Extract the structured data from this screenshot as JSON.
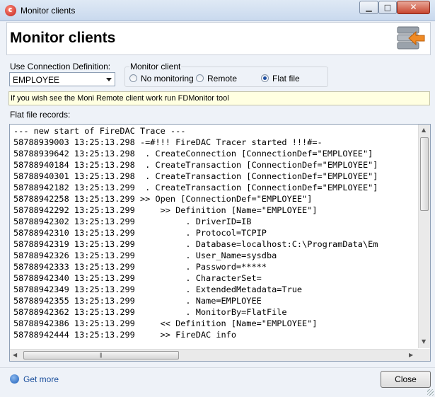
{
  "window": {
    "title": "Monitor clients",
    "minimize": "▁",
    "maximize": "□",
    "close": "✕"
  },
  "header": {
    "title": "Monitor clients",
    "icon": "database-export-icon"
  },
  "connection": {
    "label": "Use Connection Definition:",
    "selected": "EMPLOYEE"
  },
  "monitor": {
    "legend": "Monitor client",
    "options": [
      {
        "label": "No monitoring",
        "checked": false
      },
      {
        "label": "Remote",
        "checked": false
      },
      {
        "label": "Flat file",
        "checked": true
      }
    ]
  },
  "info": {
    "text": "If you wish see the Moni Remote client work run FDMonitor tool"
  },
  "log": {
    "label": "Flat file records:",
    "lines": [
      "--- new start of FireDAC Trace ---",
      "58788939003 13:25:13.298 -=#!!! FireDAC Tracer started !!!#=-",
      "58788939642 13:25:13.298  . CreateConnection [ConnectionDef=\"EMPLOYEE\"]",
      "58788940184 13:25:13.298  . CreateTransaction [ConnectionDef=\"EMPLOYEE\"]",
      "58788940301 13:25:13.298  . CreateTransaction [ConnectionDef=\"EMPLOYEE\"]",
      "58788942182 13:25:13.299  . CreateTransaction [ConnectionDef=\"EMPLOYEE\"]",
      "58788942258 13:25:13.299 >> Open [ConnectionDef=\"EMPLOYEE\"]",
      "58788942292 13:25:13.299     >> Definition [Name=\"EMPLOYEE\"]",
      "58788942302 13:25:13.299          . DriverID=IB",
      "58788942310 13:25:13.299          . Protocol=TCPIP",
      "58788942319 13:25:13.299          . Database=localhost:C:\\ProgramData\\Em",
      "58788942326 13:25:13.299          . User_Name=sysdba",
      "58788942333 13:25:13.299          . Password=*****",
      "58788942340 13:25:13.299          . CharacterSet=",
      "58788942349 13:25:13.299          . ExtendedMetadata=True",
      "58788942355 13:25:13.299          . Name=EMPLOYEE",
      "58788942362 13:25:13.299          . MonitorBy=FlatFile",
      "58788942386 13:25:13.299     << Definition [Name=\"EMPLOYEE\"]",
      "58788942444 13:25:13.299     >> FireDAC info"
    ]
  },
  "footer": {
    "get_more": "Get more",
    "close": "Close"
  }
}
